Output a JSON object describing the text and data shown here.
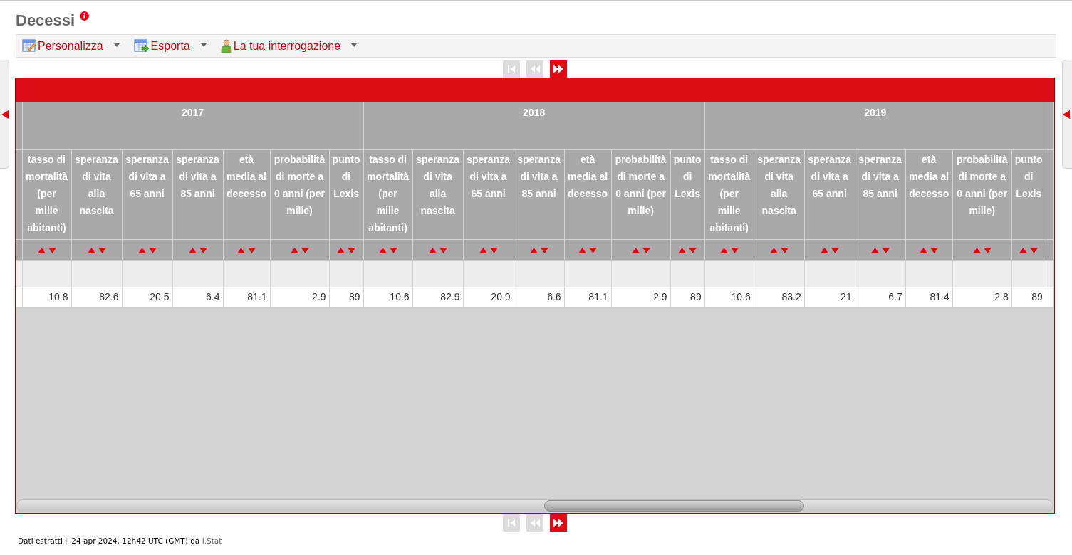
{
  "title": "Decessi",
  "toolbar": [
    {
      "label": "Personalizza",
      "kind": "edit"
    },
    {
      "label": "Esporta",
      "kind": "export"
    },
    {
      "label": "La tua interrogazione",
      "kind": "user"
    }
  ],
  "pager_top": [
    {
      "kind": "first",
      "disabled": true
    },
    {
      "kind": "previous",
      "disabled": true
    },
    {
      "kind": "next",
      "disabled": false
    }
  ],
  "years": [
    {
      "year": "2017",
      "columns": [
        {
          "label": "tasso di mortalità (per mille abitanti)",
          "value": "10.8"
        },
        {
          "label": "speranza di vita alla nascita",
          "value": "82.6"
        },
        {
          "label": "speranza di vita a 65 anni",
          "value": "20.5"
        },
        {
          "label": "speranza di vita a 85 anni",
          "value": "6.4"
        },
        {
          "label": "età media al decesso",
          "value": "81.1"
        },
        {
          "label": "probabilità di morte a 0 anni (per mille)",
          "value": "2.9"
        },
        {
          "label": "punto di Lexis",
          "value": "89"
        }
      ]
    },
    {
      "year": "2018",
      "columns": [
        {
          "label": "tasso di mortalità (per mille abitanti)",
          "value": "10.6"
        },
        {
          "label": "speranza di vita alla nascita",
          "value": "82.9"
        },
        {
          "label": "speranza di vita a 65 anni",
          "value": "20.9"
        },
        {
          "label": "speranza di vita a 85 anni",
          "value": "6.6"
        },
        {
          "label": "età media al decesso",
          "value": "81.1"
        },
        {
          "label": "probabilità di morte a 0 anni (per mille)",
          "value": "2.9"
        },
        {
          "label": "punto di Lexis",
          "value": "89"
        }
      ]
    },
    {
      "year": "2019",
      "columns": [
        {
          "label": "tasso di mortalità (per mille abitanti)",
          "value": "10.6"
        },
        {
          "label": "speranza di vita alla nascita",
          "value": "83.2"
        },
        {
          "label": "speranza di vita a 65 anni",
          "value": "21"
        },
        {
          "label": "speranza di vita a 85 anni",
          "value": "6.7"
        },
        {
          "label": "età media al decesso",
          "value": "81.4"
        },
        {
          "label": "probabilità di morte a 0 anni (per mille)",
          "value": "2.8"
        },
        {
          "label": "punto di Lexis",
          "value": "89"
        }
      ]
    }
  ],
  "pager_bottom": [
    {
      "kind": "first",
      "disabled": true
    },
    {
      "kind": "previous",
      "disabled": true
    },
    {
      "kind": "next",
      "disabled": false
    }
  ],
  "footer": {
    "text": "Dati estratti il 24 apr 2024, 12h42 UTC (GMT) da",
    "link": "I.Stat"
  }
}
